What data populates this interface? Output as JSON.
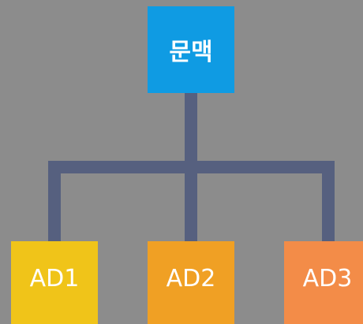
{
  "diagram": {
    "root": {
      "label": "문맥",
      "color": "#0f9be3"
    },
    "children": [
      {
        "label": "AD1",
        "color": "#f0c419"
      },
      {
        "label": "AD2",
        "color": "#f0a024"
      },
      {
        "label": "AD3",
        "color": "#f38c48"
      }
    ],
    "connector_color": "#56607f",
    "background": "#8c8c8c"
  }
}
